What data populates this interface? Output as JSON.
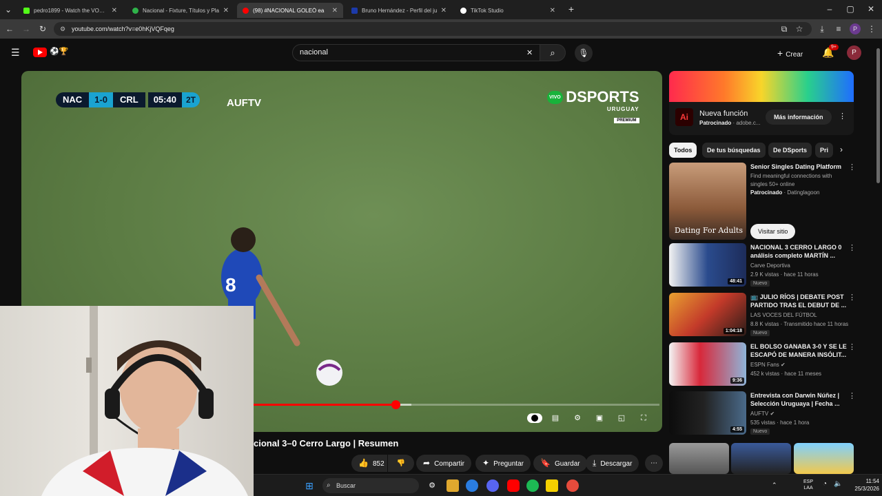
{
  "browser": {
    "tabs": [
      {
        "label": "pedro1899 - Watch the VOD on",
        "color": "#53fc18",
        "active": false
      },
      {
        "label": "Nacional - Fixture, Títulos y Pla",
        "color": "#2fb34a",
        "active": false
      },
      {
        "label": "(98) #NACIONAL GOLEÓ ea",
        "color": "#ff0000",
        "active": true
      },
      {
        "label": "Bruno Hernández - Perfil del ju",
        "color": "#1c3aa9",
        "active": false
      },
      {
        "label": "TikTok Studio",
        "color": "#ffffff",
        "active": false
      }
    ],
    "tab_close": "✕",
    "new_tab": "+",
    "url": "youtube.com/watch?v=e0hKjVQFqeg",
    "profile_initial": "P"
  },
  "youtube": {
    "search_value": "nacional",
    "create_label": "Crear",
    "notifications_count": "9+",
    "avatar_initial": "P"
  },
  "video": {
    "scorebug": {
      "home": "NAC",
      "score": "1-0",
      "away": "CRL",
      "clock": "05:40",
      "half": "2T"
    },
    "channel_bug": "AUFTV",
    "broadcaster": {
      "live": "VIVO",
      "name": "DSPORTS",
      "region": "URUGUAY",
      "tier": "PREMIUM"
    },
    "progress_fraction": 0.585,
    "buffer_fraction": 0.61,
    "title": "cional 3–0 Cerro Largo | Resumen"
  },
  "actions": {
    "likes": "852",
    "share": "Compartir",
    "ask": "Preguntar",
    "save": "Guardar",
    "download": "Descargar"
  },
  "sidebar": {
    "ad": {
      "title": "Nueva función",
      "sponsored": "Patrocinado",
      "domain": "adobe.c...",
      "cta": "Más información",
      "logo": "Ai"
    },
    "chips": [
      "Todos",
      "De tus búsquedas",
      "De DSports",
      "Pri"
    ],
    "promo": {
      "title": "Senior Singles Dating Platform",
      "desc": "Find meaningful connections with singles 50+ online",
      "sponsored": "Patrocinado",
      "advertiser": "Datinglagoon",
      "cta": "Visitar sitio",
      "thumb_text": "Dating For Adults"
    },
    "videos": [
      {
        "title": "NACIONAL 3 CERRO LARGO 0 análisis completo MARTÍN ...",
        "channel": "Carve Deportiva",
        "meta": "2.9 K vistas · hace 11 horas",
        "duration": "48:41",
        "badge": "Nuevo"
      },
      {
        "title": "📺 JULIO RÍOS | DEBATE POST PARTIDO TRAS EL DEBUT DE ...",
        "channel": "LAS VOCES DEL FÚTBOL",
        "meta": "8.8 K vistas · Transmitido hace 11 horas",
        "duration": "1:04:18",
        "badge": "Nuevo"
      },
      {
        "title": "EL BOLSO GANABA 3-0 Y SE LE ESCAPÓ DE MANERA INSÓLIT...",
        "channel": "ESPN Fans",
        "meta": "452 k vistas · hace 11 meses",
        "duration": "9:36",
        "badge": ""
      },
      {
        "title": "Entrevista con Darwin Núñez | Selección Uruguaya | Fecha ...",
        "channel": "AUFTV",
        "meta": "535 vistas · hace 1 hora",
        "duration": "4:55",
        "badge": "Nuevo"
      }
    ]
  },
  "taskbar": {
    "search_label": "Buscar",
    "lang_top": "ESP",
    "lang_bottom": "LAA",
    "time": "11:54",
    "date": "25/3/2026"
  }
}
